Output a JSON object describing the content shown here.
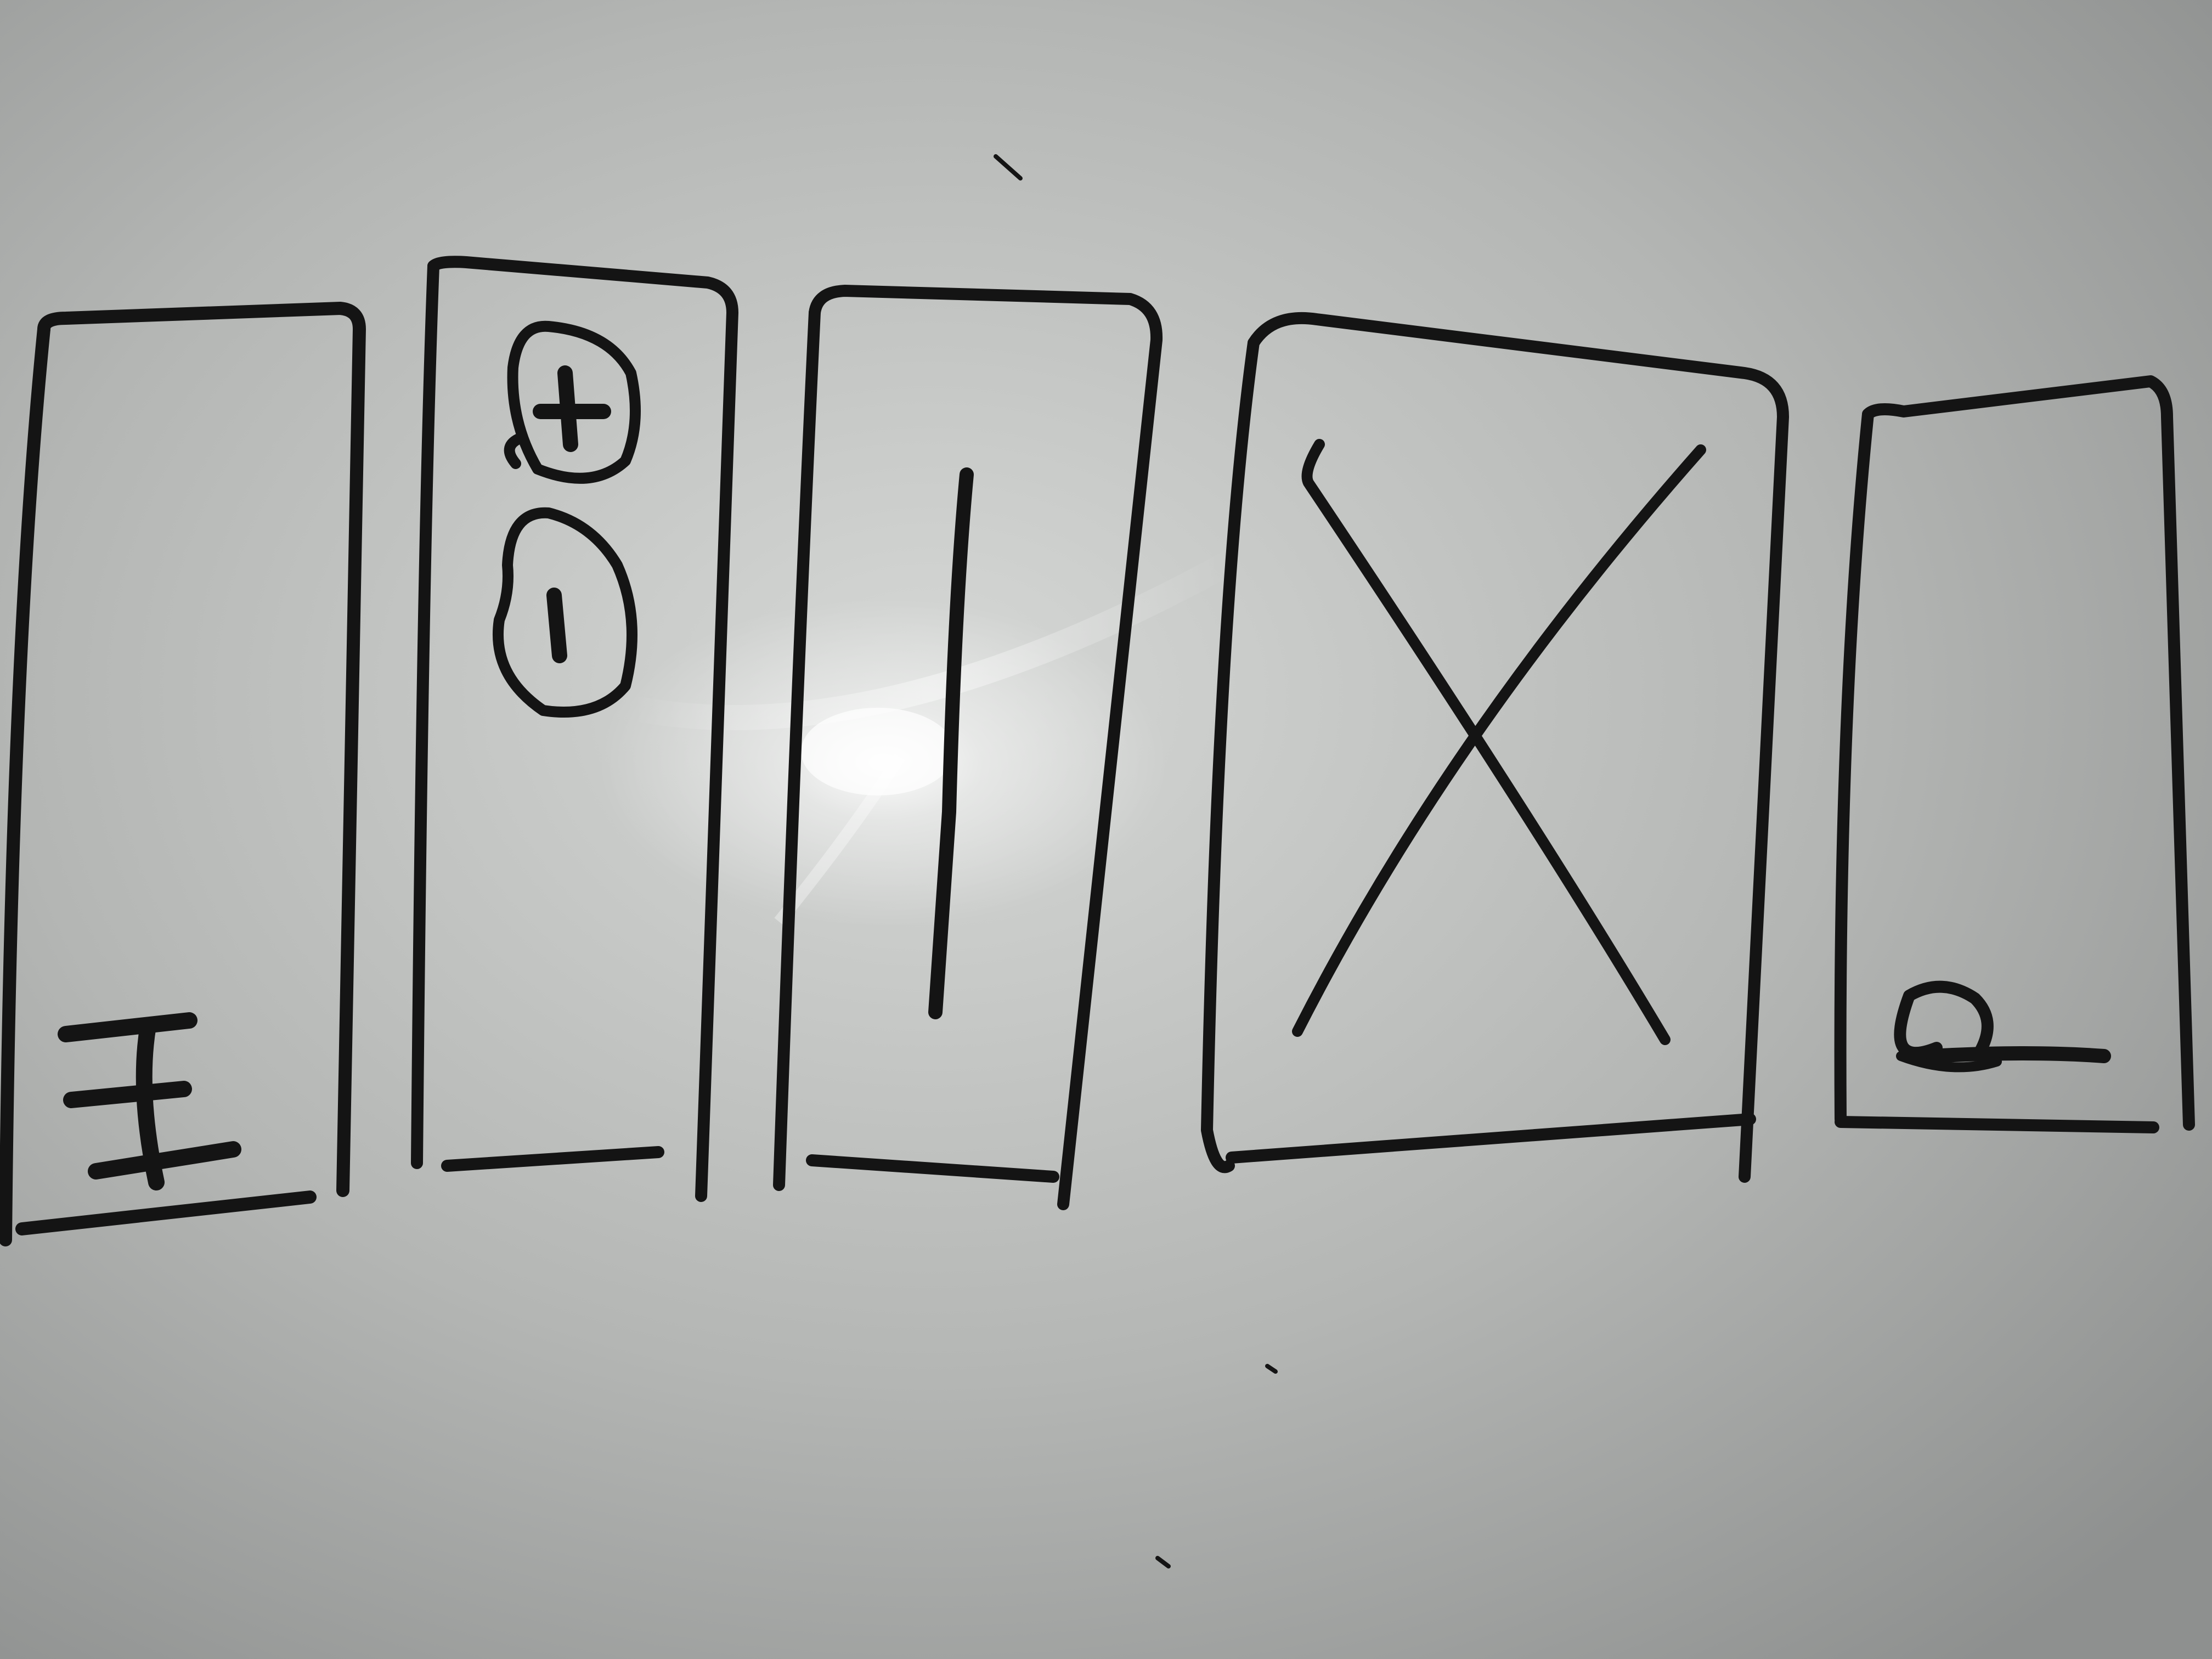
{
  "board": {
    "colors": {
      "marker": "#141414",
      "board_light": "#d6d8d6",
      "board_mid": "#b4b6b4",
      "board_dark": "#8e908f",
      "glare": "#ffffff"
    }
  },
  "sketch": {
    "panels": [
      {
        "id": "panel-1",
        "symbol": "text-cursor-icon"
      },
      {
        "id": "panel-2",
        "symbol": "plus-minus-icon"
      },
      {
        "id": "panel-3",
        "symbol": "vertical-line-icon"
      },
      {
        "id": "panel-4",
        "symbol": "x-mark-icon"
      },
      {
        "id": "panel-5",
        "symbol": "pen-tip-icon"
      }
    ]
  }
}
